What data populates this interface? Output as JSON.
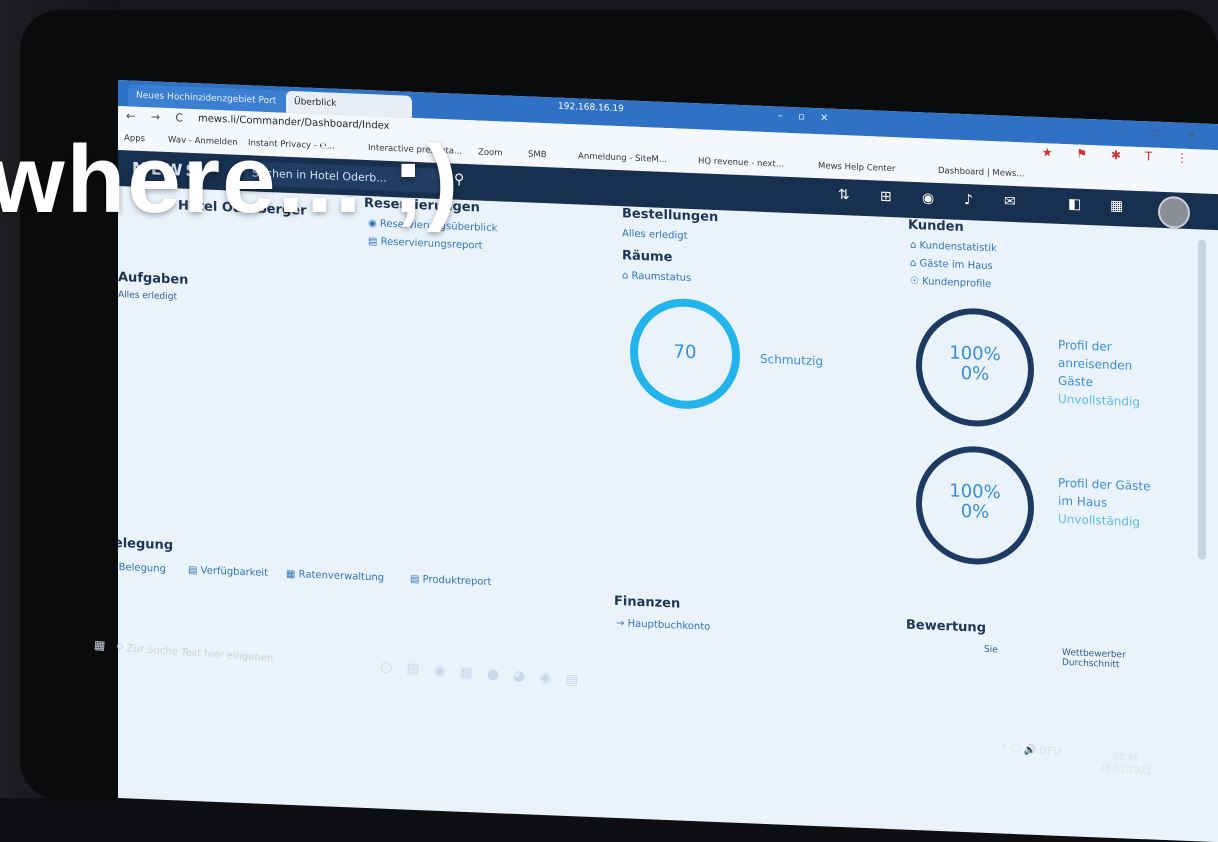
{
  "overlay_caption": "where... ;)",
  "browser": {
    "tabs": [
      {
        "label": "Neues Hochinzidenzgebiet Port",
        "close": "×"
      },
      {
        "label": "Überblick",
        "close": ""
      }
    ],
    "remote_ip": "192.168.16.19",
    "remote_controls": "– ▫ ×",
    "window_controls": "– ▫ ×",
    "nav": "← → C",
    "url": "mews.li/Commander/Dashboard/Index",
    "bookmarks": [
      "Apps",
      "Wav - Anmelden",
      "Instant Privacy - ℮...",
      "Interactive presenta...",
      "Zoom",
      "SMB",
      "Anmeldung - SiteM...",
      "HQ revenue - next...",
      "Mews Help Center",
      "Dashboard | Mews..."
    ],
    "extensions": "★ ⚑ ✱ T ⋮"
  },
  "app": {
    "logo": "MEWS",
    "search_placeholder": "Suchen in Hotel Oderb...",
    "header_icons": [
      "sort-icon",
      "add-icon",
      "eye-icon",
      "bell-icon",
      "mail-icon",
      "help-icon",
      "gift-icon"
    ]
  },
  "hotel": {
    "name": "Hotel Oderberger"
  },
  "aufgaben": {
    "title": "Aufgaben",
    "status": "Alles erledigt"
  },
  "reservierungen": {
    "title": "Reservierungen",
    "items": [
      "Reservierungsüberblick",
      "Reservierungsreport"
    ]
  },
  "bestellungen": {
    "title": "Bestellungen",
    "status": "Alles erledigt"
  },
  "raeume": {
    "title": "Räume",
    "link": "Raumstatus",
    "ring_value": "70",
    "ring_label": "Schmutzig"
  },
  "kunden": {
    "title": "Kunden",
    "links": [
      "Kundenstatistik",
      "Gäste im Haus",
      "Kundenprofile"
    ],
    "ring1": {
      "pct1": "100%",
      "pct2": "0%",
      "label": "Profil der anreisenden Gäste",
      "status": "Unvollständig"
    },
    "ring2": {
      "pct1": "100%",
      "pct2": "0%",
      "label": "Profil der Gäste im Haus",
      "status": "Unvollständig"
    }
  },
  "belegung": {
    "title": "Belegung",
    "items": [
      "Belegung",
      "Verfügbarkeit",
      "Ratenverwaltung",
      "Produktreport"
    ]
  },
  "finanzen": {
    "title": "Finanzen",
    "link": "Hauptbuchkonto"
  },
  "bewertung": {
    "title": "Bewertung",
    "col1": "Sie",
    "col2": "Wettbewerber Durchschnitt"
  },
  "taskbar": {
    "search_placeholder": "Zur Suche Text hier eingeben",
    "tray": "^ ☐ 🔊 DEU",
    "time": "08:46",
    "date": "26.01.2021"
  },
  "colors": {
    "brand_dark": "#17304f",
    "accent": "#2f74b8",
    "ring_light": "#22b4ea",
    "ring_dark": "#1d3a63"
  }
}
